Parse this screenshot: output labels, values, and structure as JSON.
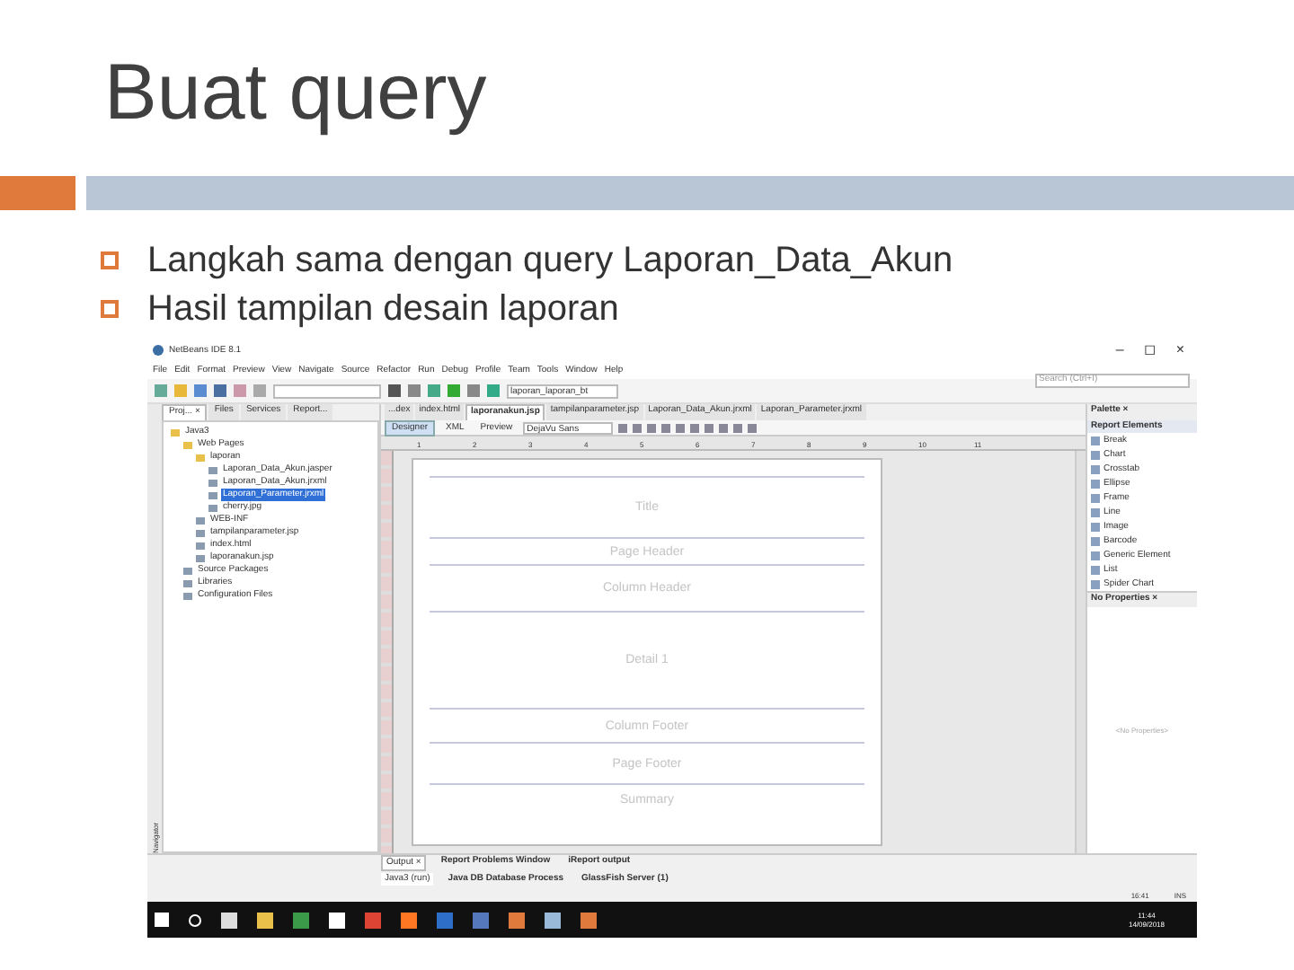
{
  "slide": {
    "title": "Buat query",
    "bullets": [
      "Langkah sama dengan query Laporan_Data_Akun",
      "Hasil tampilan desain laporan"
    ]
  },
  "ide": {
    "window_title": "NetBeans IDE 8.1",
    "search_placeholder": "Search (Ctrl+I)",
    "window_buttons": [
      "–",
      "◻",
      "×"
    ],
    "menu": [
      "File",
      "Edit",
      "Format",
      "Preview",
      "View",
      "Navigate",
      "Source",
      "Refactor",
      "Run",
      "Debug",
      "Profile",
      "Team",
      "Tools",
      "Window",
      "Help"
    ],
    "config_field": "laporan_laporan_bt",
    "side_strip": "Navigator",
    "project_tabs": [
      {
        "label": "Proj... ×",
        "selected": true
      },
      {
        "label": "Files",
        "selected": false
      },
      {
        "label": "Services",
        "selected": false
      },
      {
        "label": "Report...",
        "selected": false
      }
    ],
    "tree": [
      {
        "label": "Java3",
        "selected": false,
        "children": [
          {
            "label": "Web Pages",
            "selected": false,
            "children": [
              {
                "label": "laporan",
                "selected": false,
                "children": [
                  {
                    "label": "Laporan_Data_Akun.jasper",
                    "selected": false
                  },
                  {
                    "label": "Laporan_Data_Akun.jrxml",
                    "selected": false
                  },
                  {
                    "label": "Laporan_Parameter.jrxml",
                    "selected": true
                  },
                  {
                    "label": "cherry.jpg",
                    "selected": false
                  }
                ]
              },
              {
                "label": "WEB-INF",
                "selected": false
              },
              {
                "label": "tampilanparameter.jsp",
                "selected": false
              },
              {
                "label": "index.html",
                "selected": false
              },
              {
                "label": "laporanakun.jsp",
                "selected": false
              }
            ]
          },
          {
            "label": "Source Packages",
            "selected": false
          },
          {
            "label": "Libraries",
            "selected": false
          },
          {
            "label": "Configuration Files",
            "selected": false
          }
        ]
      }
    ],
    "editor_tabs": [
      {
        "label": "...dex",
        "selected": false
      },
      {
        "label": "index.html",
        "selected": false
      },
      {
        "label": "laporanakun.jsp",
        "selected": true
      },
      {
        "label": "tampilanparameter.jsp",
        "selected": false
      },
      {
        "label": "Laporan_Data_Akun.jrxml",
        "selected": false
      },
      {
        "label": "Laporan_Parameter.jrxml",
        "selected": false
      }
    ],
    "designer_tabs": [
      {
        "label": "Designer",
        "selected": true
      },
      {
        "label": "XML",
        "selected": false
      },
      {
        "label": "Preview",
        "selected": false
      }
    ],
    "font_field": "DejaVu Sans",
    "ruler": [
      "1",
      "2",
      "3",
      "4",
      "5",
      "6",
      "7",
      "8",
      "9",
      "10",
      "11"
    ],
    "bands": [
      "Title",
      "Page Header",
      "Column Header",
      "Detail 1",
      "Column Footer",
      "Page Footer",
      "Summary"
    ],
    "palette": {
      "title": "Palette ×",
      "group": "Report Elements",
      "items": [
        "Break",
        "Chart",
        "Crosstab",
        "Ellipse",
        "Frame",
        "Line",
        "Image",
        "Barcode",
        "Generic Element",
        "List",
        "Spider Chart"
      ]
    },
    "properties": {
      "title": "No Properties ×",
      "empty": "<No Properties>"
    },
    "output_tabs": [
      {
        "label": "Output ×",
        "selected": true
      },
      {
        "label": "Report Problems Window",
        "selected": false
      },
      {
        "label": "iReport output",
        "selected": false
      }
    ],
    "output_subtabs": [
      {
        "label": "Java3 (run)",
        "selected": true
      },
      {
        "label": "Java DB Database Process",
        "selected": false
      },
      {
        "label": "GlassFish Server (1)",
        "selected": false
      }
    ],
    "status": [
      "16:41",
      "INS"
    ],
    "clock": {
      "time": "11:44",
      "date": "14/09/2018"
    }
  }
}
